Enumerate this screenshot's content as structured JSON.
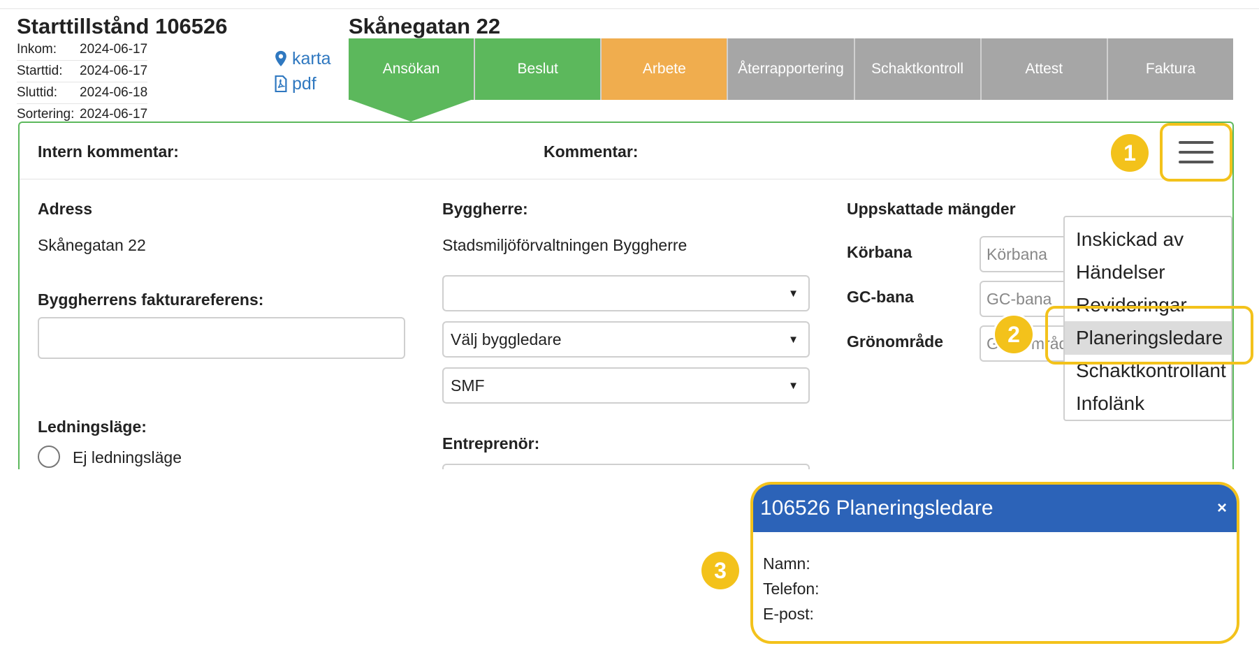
{
  "header": {
    "permit_title": "Starttillstånd 106526",
    "street_title": "Skånegatan 22",
    "dates": [
      {
        "label": "Inkom:",
        "value": "2024-06-17"
      },
      {
        "label": "Starttid:",
        "value": "2024-06-17"
      },
      {
        "label": "Sluttid:",
        "value": "2024-06-18"
      },
      {
        "label": "Sortering:",
        "value": "2024-06-17"
      }
    ],
    "links": {
      "map": "karta",
      "pdf": "pdf"
    }
  },
  "steps": [
    {
      "label": "Ansökan",
      "color": "#5cb85c"
    },
    {
      "label": "Beslut",
      "color": "#5cb85c"
    },
    {
      "label": "Arbete",
      "color": "#f0ad4e"
    },
    {
      "label": "Återrapportering",
      "color": "#a6a6a6"
    },
    {
      "label": "Schaktkontroll",
      "color": "#a6a6a6"
    },
    {
      "label": "Attest",
      "color": "#a6a6a6"
    },
    {
      "label": "Faktura",
      "color": "#a6a6a6"
    }
  ],
  "comments": {
    "internal_label": "Intern kommentar:",
    "public_label": "Kommentar:"
  },
  "address": {
    "label": "Adress",
    "value": "Skånegatan 22"
  },
  "invoice_ref": {
    "label": "Byggherrens fakturareferens:",
    "value": ""
  },
  "byggherre": {
    "label": "Byggherre:",
    "value": "Stadsmiljöförvaltningen Byggherre",
    "select_empty": "",
    "select_leader": "Välj byggledare",
    "select_org": "SMF"
  },
  "ledningslage": {
    "label": "Ledningsläge:",
    "option": "Ej ledningsläge"
  },
  "entreprenor": {
    "label": "Entreprenör:"
  },
  "quantities": {
    "title": "Uppskattade mängder",
    "rows": [
      {
        "label": "Körbana",
        "placeholder": "Körbana"
      },
      {
        "label": "GC-bana",
        "placeholder": "GC-bana"
      },
      {
        "label": "Grönområde",
        "placeholder": "Grönområde"
      }
    ]
  },
  "menu": {
    "items": [
      {
        "label": "Inskickad av"
      },
      {
        "label": "Händelser"
      },
      {
        "label": "Revideringar"
      },
      {
        "label": "Planeringsledare"
      },
      {
        "label": "Schaktkontrollant"
      },
      {
        "label": "Infolänk"
      }
    ]
  },
  "callouts": {
    "one": "1",
    "two": "2",
    "three": "3"
  },
  "modal": {
    "title": "106526 Planeringsledare",
    "close": "×",
    "name_label": "Namn:",
    "phone_label": "Telefon:",
    "email_label": "E-post:"
  },
  "colors": {
    "green": "#5cb85c",
    "orange": "#f0ad4e",
    "gray": "#a6a6a6",
    "highlight": "#f3c21b",
    "modal_header": "#2c63b8",
    "link": "#2f78c0"
  }
}
